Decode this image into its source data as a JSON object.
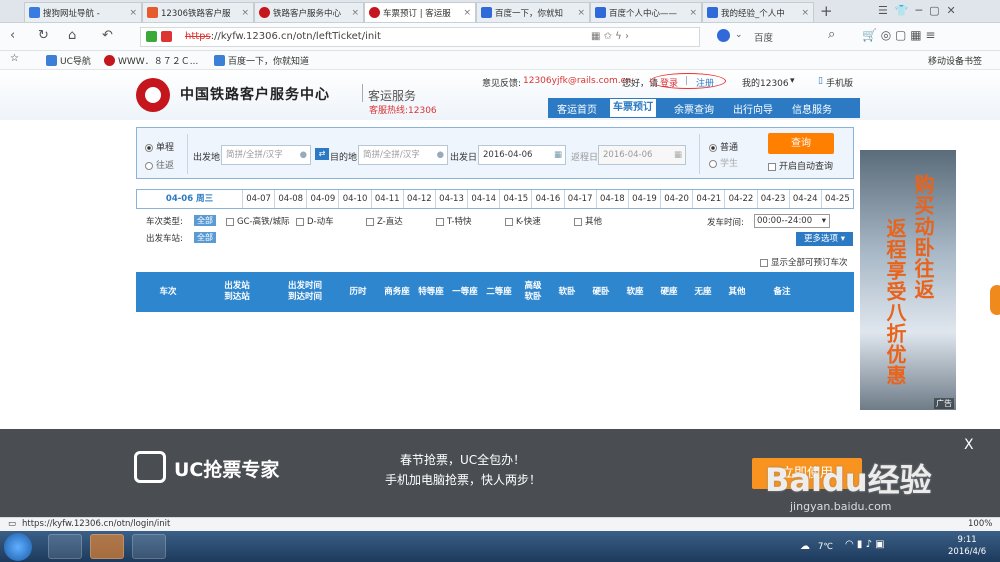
{
  "browser": {
    "tabs": [
      {
        "label": "搜狗网址导航 - ",
        "color": "#3a7be0"
      },
      {
        "label": "12306铁路客户服",
        "color": "#e55b2e"
      },
      {
        "label": "铁路客户服务中心",
        "color": "#c4161c"
      },
      {
        "label": "车票预订 | 客运服",
        "color": "#c4161c"
      },
      {
        "label": "百度一下，你就知",
        "color": "#2f6ad8"
      },
      {
        "label": "百度个人中心——",
        "color": "#2f6ad8"
      },
      {
        "label": "我的经验_个人中",
        "color": "#2f6ad8"
      }
    ],
    "new_tab": "+",
    "url_scheme": "https",
    "url_rest": "://kyfw.12306.cn/otn/leftTicket/init",
    "search_engine": "百度",
    "bookmarks": [
      "UC导航",
      "WWW．８７２Ｃ...",
      "百度一下，你就知道"
    ],
    "bookmarks_right": "移动设备书签",
    "status_url": "https://kyfw.12306.cn/otn/login/init",
    "zoom": "100%"
  },
  "site": {
    "title": "中国铁路客户服务中心",
    "subtitle": "客运服务",
    "hotline": "客服热线:12306",
    "feedback_label": "意见反馈:",
    "feedback_email": "12306yjfk@rails.com.cn",
    "greeting": "您好，请",
    "login": "登录",
    "separator": "|",
    "register": "注册",
    "my12306": "我的12306",
    "mobile": "手机版",
    "nav": [
      "客运首页",
      "车票预订",
      "余票查询",
      "出行向导",
      "信息服务"
    ]
  },
  "search": {
    "trip_oneway": "单程",
    "trip_return": "往返",
    "from_label": "出发地",
    "from_placeholder": "简拼/全拼/汉字",
    "to_label": "目的地",
    "to_placeholder": "简拼/全拼/汉字",
    "depart_label": "出发日",
    "depart_value": "2016-04-06",
    "return_label": "返程日",
    "return_value": "2016-04-06",
    "type_normal": "普通",
    "type_student": "学生",
    "query_button": "查询",
    "auto_query": "开启自动查询"
  },
  "dates": {
    "selected": "04-06 周三",
    "list": [
      "04-07",
      "04-08",
      "04-09",
      "04-10",
      "04-11",
      "04-12",
      "04-13",
      "04-14",
      "04-15",
      "04-16",
      "04-17",
      "04-18",
      "04-19",
      "04-20",
      "04-21",
      "04-22",
      "04-23",
      "04-24",
      "04-25"
    ]
  },
  "filters": {
    "train_type_label": "车次类型:",
    "all": "全部",
    "types": [
      "GC-高铁/城际",
      "D-动车",
      "Z-直达",
      "T-特快",
      "K-快速",
      "其他"
    ],
    "depart_time_label": "发车时间:",
    "depart_time_value": "00:00--24:00",
    "station_label": "出发车站:",
    "station_all": "全部",
    "more": "更多选项",
    "show_all": "显示全部可预订车次"
  },
  "table": {
    "headers": [
      "车次",
      "出发站\n到达站",
      "出发时间\n到达时间",
      "历时",
      "商务座",
      "特等座",
      "一等座",
      "二等座",
      "高级\n软卧",
      "软卧",
      "硬卧",
      "软座",
      "硬座",
      "无座",
      "其他",
      "备注"
    ]
  },
  "ad": {
    "line1": "购买动卧往返",
    "line2": "返程享受八折优惠",
    "tag": "广告"
  },
  "ucbar": {
    "brand": "UC抢票专家",
    "line1": "春节抢票，UC全包办！",
    "line2": "手机加电脑抢票，快人两步！",
    "button": "立即使用",
    "close": "X"
  },
  "taskbar": {
    "temp": "7℃",
    "time": "9:11",
    "date": "2016/4/6"
  },
  "watermark": "Baidu经验",
  "watermark_url": "jingyan.baidu.com"
}
